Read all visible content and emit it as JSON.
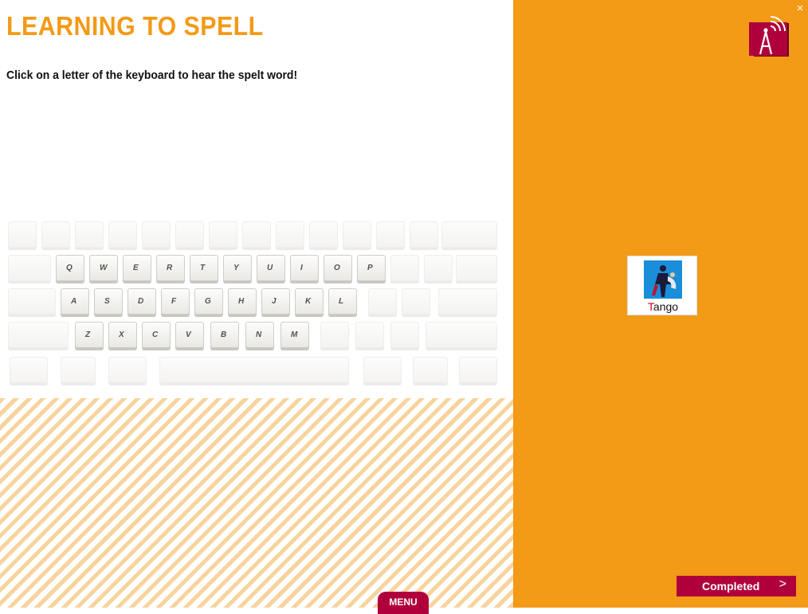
{
  "header": {
    "title": "LEARNING TO SPELL",
    "instruction": "Click on a letter of the keyboard to hear the spelt word!"
  },
  "keyboard": {
    "row1": [
      "Q",
      "W",
      "E",
      "R",
      "T",
      "Y",
      "U",
      "I",
      "O",
      "P"
    ],
    "row2": [
      "A",
      "S",
      "D",
      "F",
      "G",
      "H",
      "J",
      "K",
      "L"
    ],
    "row3": [
      "Z",
      "X",
      "C",
      "V",
      "B",
      "N",
      "M"
    ]
  },
  "word_card": {
    "first_letter": "T",
    "rest": "ango",
    "image": "tango-dancers-icon"
  },
  "buttons": {
    "menu": "MENU",
    "completed": "Completed",
    "completed_arrow": ">",
    "close": "×"
  },
  "colors": {
    "accent": "#f39a16",
    "button": "#b0003c"
  }
}
